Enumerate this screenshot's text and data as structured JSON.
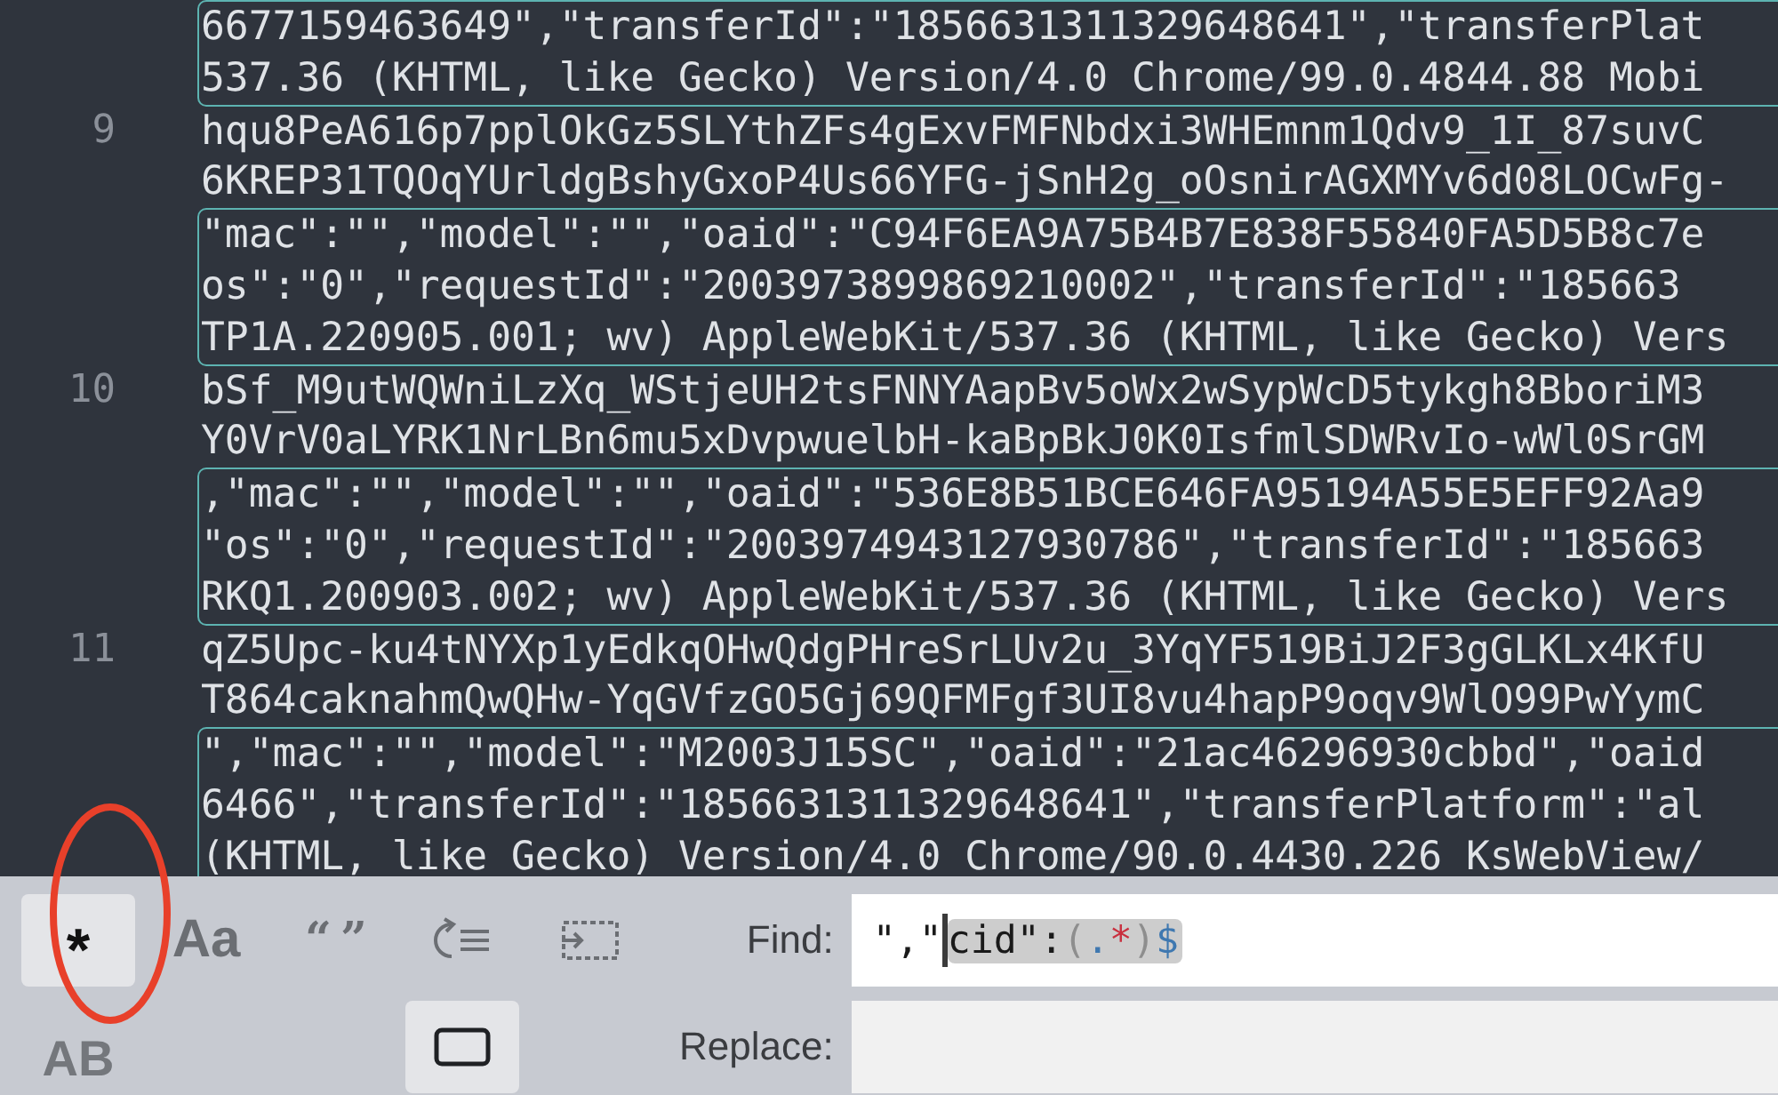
{
  "editor": {
    "rows": [
      {
        "text": "6677159463649\",\"transferId\":\"1856631311329648641\",\"transferPlat",
        "match": true
      },
      {
        "text": "537.36 (KHTML, like Gecko) Version/4.0 Chrome/99.0.4844.88 Mobi",
        "match": true
      },
      {
        "number": "9",
        "text": "hqu8PeA616p7pplOkGz5SLYthZFs4gExvFMFNbdxi3WHEmnm1Qdv9_1I_87suvC",
        "match": false
      },
      {
        "text": "6KREP31TQOqYUrldgBshyGxoP4Us66YFG-jSnH2g_oOsnirAGXMYv6d08LOCwFg-",
        "match": false
      },
      {
        "text": "\"mac\":\"\",\"model\":\"\",\"oaid\":\"C94F6EA9A75B4B7E838F55840FA5D5B8c7e",
        "match": true
      },
      {
        "text": "os\":\"0\",\"requestId\":\"2003973899869210002\",\"transferId\":\"185663",
        "match": true
      },
      {
        "text": "TP1A.220905.001; wv) AppleWebKit/537.36 (KHTML, like Gecko) Vers",
        "match": true
      },
      {
        "number": "10",
        "text": "bSf_M9utWQWniLzXq_WStjeUH2tsFNNYAapBv5oWx2wSypWcD5tykgh8BboriM3",
        "match": false
      },
      {
        "text": "Y0VrV0aLYRK1NrLBn6mu5xDvpwuelbH-kaBpBkJ0K0IsfmlSDWRvIo-wWl0SrGM",
        "match": false
      },
      {
        "text": ",\"mac\":\"\",\"model\":\"\",\"oaid\":\"536E8B51BCE646FA95194A55E5EFF92Aa9",
        "match": true
      },
      {
        "text": "\"os\":\"0\",\"requestId\":\"2003974943127930786\",\"transferId\":\"185663",
        "match": true
      },
      {
        "text": "RKQ1.200903.002; wv) AppleWebKit/537.36 (KHTML, like Gecko) Vers",
        "match": true
      },
      {
        "number": "11",
        "text": "qZ5Upc-ku4tNYXp1yEdkqOHwQdgPHreSrLUv2u_3YqYF519BiJ2F3gGLKLx4KfU",
        "match": false
      },
      {
        "text": "T864caknahmQwQHw-YqGVfzGO5Gj69QFMFgf3UI8vu4hapP9oqv9WlO99PwYymC",
        "match": false
      },
      {
        "text": "\",\"mac\":\"\",\"model\":\"M2003J15SC\",\"oaid\":\"21ac46296930cbbd\",\"oaid",
        "match": true
      },
      {
        "text": "6466\",\"transferId\":\"1856631311329648641\",\"transferPlatform\":\"al",
        "match": true
      },
      {
        "text": "(KHTML, like Gecko) Version/4.0 Chrome/90.0.4430.226 KsWebView/",
        "match": true
      }
    ]
  },
  "find_panel": {
    "toggles": [
      {
        "kind": "regex",
        "label": "*",
        "selected": true
      },
      {
        "kind": "case",
        "label": "Aa",
        "selected": false
      },
      {
        "kind": "word",
        "label": "“ ”",
        "selected": false
      },
      {
        "kind": "wrap",
        "selected": false
      },
      {
        "kind": "in_selection",
        "selected": false
      },
      {
        "kind": "preserve_case",
        "label": "AB",
        "selected": false
      },
      {
        "kind": "gap"
      },
      {
        "kind": "gap"
      },
      {
        "kind": "highlight",
        "selected": true
      }
    ],
    "find_label": "Find:",
    "find_tokens": [
      {
        "text": "\",\"",
        "kind": "literal",
        "selected": false
      },
      {
        "text": "cid\":",
        "kind": "literal",
        "selected": true
      },
      {
        "text": "(",
        "kind": "group",
        "selected": true
      },
      {
        "text": ".",
        "kind": "dot",
        "selected": true
      },
      {
        "text": "*",
        "kind": "quantifier",
        "selected": true
      },
      {
        "text": ")",
        "kind": "group",
        "selected": true
      },
      {
        "text": "$",
        "kind": "anchor",
        "selected": true
      }
    ],
    "replace_label": "Replace:"
  },
  "annotations": [
    {
      "kind": "ellipse",
      "color": "#e8402a"
    }
  ]
}
